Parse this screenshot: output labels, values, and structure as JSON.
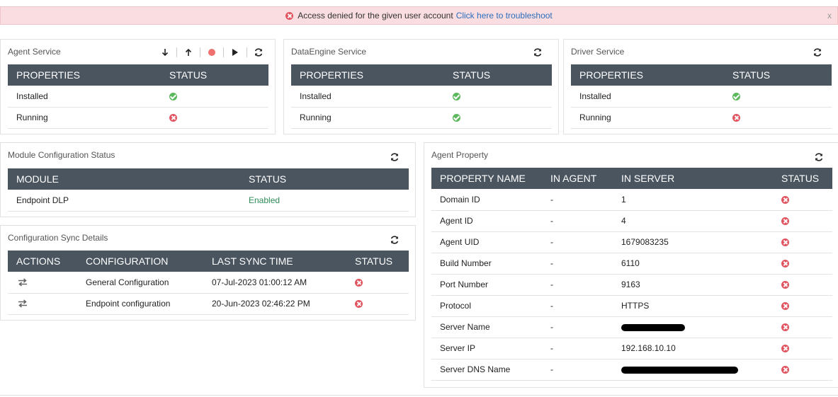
{
  "alert": {
    "message": "Access denied for the given user account",
    "link_text": "Click here to troubleshoot",
    "close_label": "x"
  },
  "agent_service": {
    "title": "Agent Service",
    "headers": [
      "PROPERTIES",
      "STATUS"
    ],
    "rows": [
      {
        "property": "Installed",
        "status": "ok"
      },
      {
        "property": "Running",
        "status": "error"
      }
    ]
  },
  "dataengine_service": {
    "title": "DataEngine Service",
    "headers": [
      "PROPERTIES",
      "STATUS"
    ],
    "rows": [
      {
        "property": "Installed",
        "status": "ok"
      },
      {
        "property": "Running",
        "status": "ok"
      }
    ]
  },
  "driver_service": {
    "title": "Driver Service",
    "headers": [
      "PROPERTIES",
      "STATUS"
    ],
    "rows": [
      {
        "property": "Installed",
        "status": "ok"
      },
      {
        "property": "Running",
        "status": "error"
      }
    ]
  },
  "module_config": {
    "title": "Module Configuration Status",
    "headers": [
      "MODULE",
      "STATUS"
    ],
    "rows": [
      {
        "module": "Endpoint DLP",
        "status": "Enabled"
      }
    ]
  },
  "config_sync": {
    "title": "Configuration Sync Details",
    "headers": [
      "ACTIONS",
      "CONFIGURATION",
      "LAST SYNC TIME",
      "STATUS"
    ],
    "rows": [
      {
        "configuration": "General Configuration",
        "last_sync": "07-Jul-2023 01:00:12 AM",
        "status": "error"
      },
      {
        "configuration": "Endpoint configuration",
        "last_sync": "20-Jun-2023 02:46:22 PM",
        "status": "error"
      }
    ]
  },
  "agent_property": {
    "title": "Agent Property",
    "headers": [
      "PROPERTY NAME",
      "IN AGENT",
      "IN SERVER",
      "STATUS"
    ],
    "rows": [
      {
        "name": "Domain ID",
        "in_agent": "-",
        "in_server": "1",
        "status": "error"
      },
      {
        "name": "Agent ID",
        "in_agent": "-",
        "in_server": "4",
        "status": "error"
      },
      {
        "name": "Agent UID",
        "in_agent": "-",
        "in_server": "1679083235",
        "status": "error"
      },
      {
        "name": "Build Number",
        "in_agent": "-",
        "in_server": "6110",
        "status": "error"
      },
      {
        "name": "Port Number",
        "in_agent": "-",
        "in_server": "9163",
        "status": "error"
      },
      {
        "name": "Protocol",
        "in_agent": "-",
        "in_server": "HTTPS",
        "status": "error"
      },
      {
        "name": "Server Name",
        "in_agent": "-",
        "in_server": "",
        "status": "error",
        "redacted": true
      },
      {
        "name": "Server IP",
        "in_agent": "-",
        "in_server": "192.168.10.10",
        "status": "error"
      },
      {
        "name": "Server DNS Name",
        "in_agent": "-",
        "in_server": "",
        "status": "error",
        "redacted": true
      }
    ]
  },
  "colors": {
    "header_bg": "#4a555f",
    "ok": "#5cb85c",
    "error": "#e05560",
    "alert_bg": "#f9dde0",
    "link": "#2a6ebd",
    "record_dot": "#f07070"
  },
  "icons": {
    "refresh": "refresh-icon",
    "sync": "sync-icon",
    "download": "download-icon",
    "upload": "upload-icon",
    "record": "record-icon",
    "play": "play-icon"
  }
}
